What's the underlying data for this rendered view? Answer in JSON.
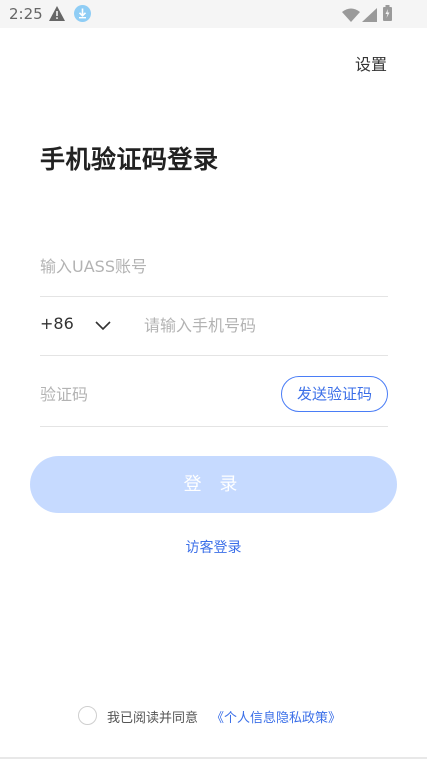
{
  "status_bar": {
    "time": "2:25",
    "icons": [
      "warning-icon",
      "download-icon",
      "wifi-icon",
      "signal-icon",
      "battery-icon"
    ],
    "download_color": "#8fcdf5"
  },
  "header": {
    "settings_label": "设置",
    "title": "手机验证码登录"
  },
  "form": {
    "account_placeholder": "输入UASS账号",
    "country_code": "+86",
    "phone_placeholder": "请输入手机号码",
    "code_placeholder": "验证码",
    "send_code_label": "发送验证码"
  },
  "actions": {
    "login_label": "登 录",
    "guest_login_label": "访客登录"
  },
  "agreement": {
    "text": "我已阅读并同意",
    "link_text": "《个人信息隐私政策》",
    "checked": false
  },
  "colors": {
    "accent": "#3b6fe8",
    "login_button_bg": "#c6daff",
    "divider": "#e4e4e4",
    "placeholder": "#b3b3b3"
  }
}
